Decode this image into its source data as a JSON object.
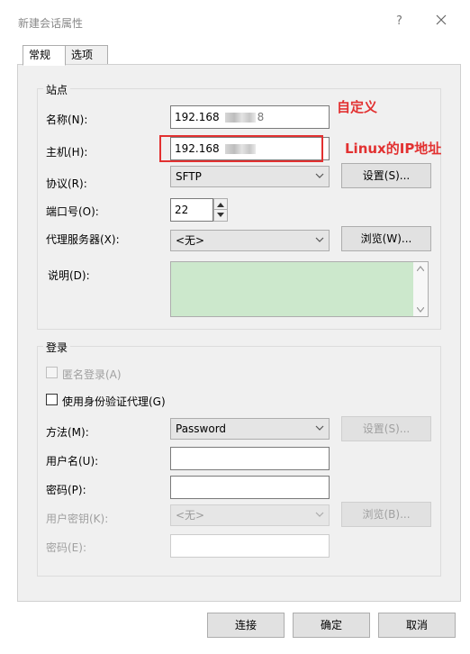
{
  "window": {
    "title": "新建会话属性",
    "help": "?",
    "close": "×"
  },
  "tabs": [
    {
      "label": "常规",
      "active": true
    },
    {
      "label": "选项",
      "active": false
    }
  ],
  "site": {
    "title": "站点",
    "name_label": "名称(N):",
    "name_value": "192.168",
    "name_tail": "8",
    "host_label": "主机(H):",
    "host_value": "192.168",
    "protocol_label": "协议(R):",
    "protocol_value": "SFTP",
    "settings_button": "设置(S)...",
    "port_label": "端口号(O):",
    "port_value": "22",
    "proxy_label": "代理服务器(X):",
    "proxy_value": "<无>",
    "browse_button": "浏览(W)...",
    "desc_label": "说明(D):"
  },
  "login": {
    "title": "登录",
    "anon_label": "匿名登录(A)",
    "agent_label": "使用身份验证代理(G)",
    "method_label": "方法(M):",
    "method_value": "Password",
    "method_settings_button": "设置(S)...",
    "user_label": "用户名(U):",
    "password_label": "密码(P):",
    "key_label": "用户密钥(K):",
    "key_value": "<无>",
    "key_browse_button": "浏览(B)...",
    "passphrase_label": "密码(E):"
  },
  "footer": {
    "connect": "连接",
    "ok": "确定",
    "cancel": "取消"
  },
  "annotations": {
    "custom": "自定义",
    "linux_ip": "Linux的IP地址"
  },
  "colors": {
    "annotation": "#e23131",
    "description_bg": "#cce8cc"
  }
}
